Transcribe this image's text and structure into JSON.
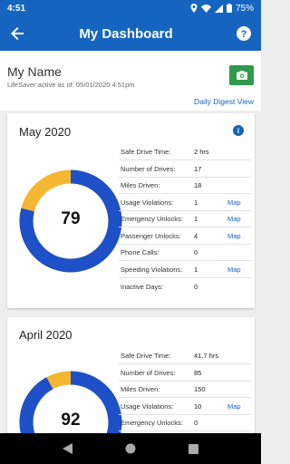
{
  "status": {
    "time": "4:51",
    "battery": "75%",
    "icons": [
      "location-icon",
      "wifi-icon",
      "signal-icon",
      "battery-icon"
    ]
  },
  "header": {
    "title": "My Dashboard",
    "back_icon": "arrow-left-icon",
    "help_icon": "help-circle-icon"
  },
  "profile": {
    "name": "My Name",
    "active_text": "LifeSaver active as of: 05/01/2020 4:51pm",
    "digest_link": "Daily Digest View",
    "camera_icon": "camera-icon",
    "camera_color": "#2e9a4a"
  },
  "colors": {
    "primary": "#1565c0",
    "donut_blue": "#1e50c8",
    "donut_yellow": "#f5b731"
  },
  "months": [
    {
      "title": "May 2020",
      "score": "79",
      "score_fraction": 0.79,
      "stats": [
        {
          "label": "Safe Drive Time:",
          "value": "2 hrs",
          "link": ""
        },
        {
          "label": "Number of Drives:",
          "value": "17",
          "link": ""
        },
        {
          "label": "Miles Driven:",
          "value": "18",
          "link": ""
        },
        {
          "label": "Usage Violations:",
          "value": "1",
          "link": "Map"
        },
        {
          "label": "Emergency Unlocks:",
          "value": "1",
          "link": "Map"
        },
        {
          "label": "Passenger Unlocks:",
          "value": "4",
          "link": "Map"
        },
        {
          "label": "Phone Calls:",
          "value": "0",
          "link": ""
        },
        {
          "label": "Speeding Violations:",
          "value": "1",
          "link": "Map"
        },
        {
          "label": "Inactive Days:",
          "value": "0",
          "link": ""
        }
      ]
    },
    {
      "title": "April 2020",
      "score": "92",
      "score_fraction": 0.92,
      "stats": [
        {
          "label": "Safe Drive Time:",
          "value": "41.7 hrs",
          "link": ""
        },
        {
          "label": "Number of Drives:",
          "value": "85",
          "link": ""
        },
        {
          "label": "Miles Driven:",
          "value": "150",
          "link": ""
        },
        {
          "label": "Usage Violations:",
          "value": "10",
          "link": "Map"
        },
        {
          "label": "Emergency Unlocks:",
          "value": "0",
          "link": ""
        }
      ]
    }
  ]
}
